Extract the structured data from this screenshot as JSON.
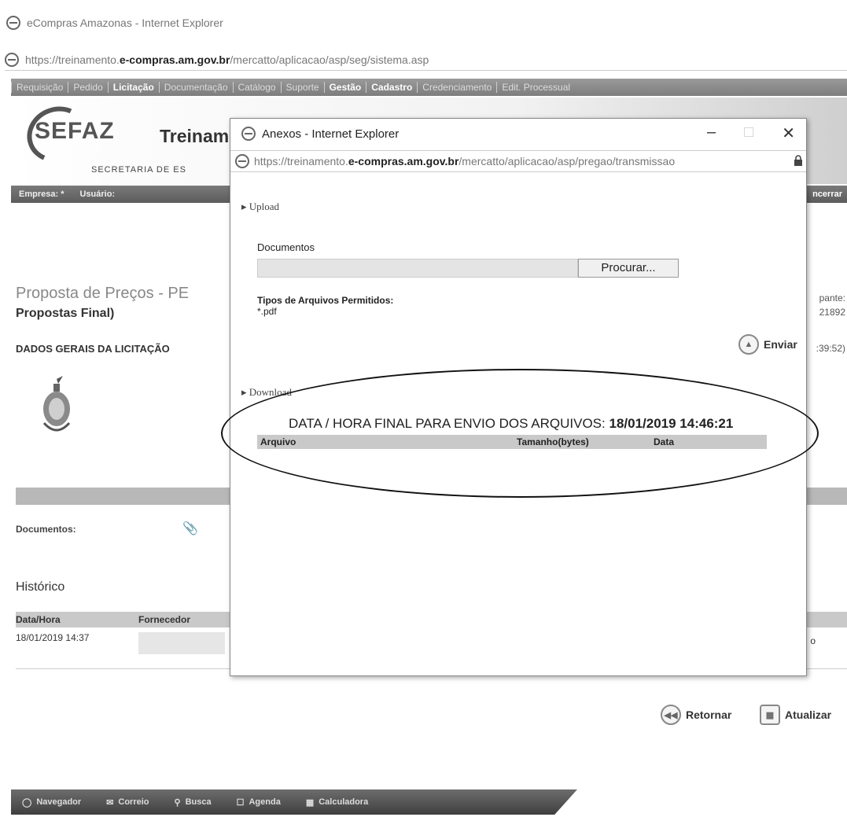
{
  "window": {
    "title": "eCompras Amazonas - Internet Explorer",
    "url_prefix": "https://treinamento.",
    "url_host": "e-compras.am.gov.br",
    "url_path": "/mercatto/aplicacao/asp/seg/sistema.asp"
  },
  "menu": {
    "items": [
      {
        "label": "Requisição",
        "bold": false
      },
      {
        "label": "Pedido",
        "bold": false
      },
      {
        "label": "Licitação",
        "bold": true
      },
      {
        "label": "Documentação",
        "bold": false
      },
      {
        "label": "Catálogo",
        "bold": false
      },
      {
        "label": "Suporte",
        "bold": false
      },
      {
        "label": "Gestão",
        "bold": true
      },
      {
        "label": "Cadastro",
        "bold": true
      },
      {
        "label": "Credenciamento",
        "bold": false
      },
      {
        "label": "Edit. Processual",
        "bold": false
      }
    ]
  },
  "header": {
    "logo": "SEFAZ",
    "title": "Treinam",
    "secretaria": "SECRETARIA DE ES",
    "empresa_label": "Empresa: *",
    "usuario_label": "Usuário:",
    "encerrar": "ncerrar"
  },
  "page": {
    "heading": "Proposta de Preços - PE",
    "subheading": "Propostas Final)",
    "right_label": "pante:",
    "right_number": "21892",
    "dados_gerais": "DADOS GERAIS DA LICITAÇÃO",
    "right_time": ":39:52)",
    "documentos_label": "Documentos:",
    "historico": "Histórico",
    "hist_columns": [
      "Data/Hora",
      "Fornecedor"
    ],
    "hist_row_date": "18/01/2019 14:37",
    "hist_row_tail": "o",
    "retornar": "Retornar",
    "atualizar": "Atualizar"
  },
  "taskbar": {
    "items": [
      "Navegador",
      "Correio",
      "Busca",
      "Agenda",
      "Calculadora"
    ]
  },
  "popup": {
    "title": "Anexos - Internet Explorer",
    "url_prefix": "https://treinamento.",
    "url_host": "e-compras.am.gov.br",
    "url_path": "/mercatto/aplicacao/asp/pregao/transmissao",
    "upload_label": "Upload",
    "documentos_label": "Documentos",
    "procurar": "Procurar...",
    "tipos_label": "Tipos de Arquivos Permitidos:",
    "tipos_value": "*.pdf",
    "enviar": "Enviar",
    "download_label": "Download",
    "data_hora_text": "DATA / HORA FINAL PARA ENVIO DOS ARQUIVOS:",
    "data_hora_value": "18/01/2019 14:46:21",
    "columns": [
      "Arquivo",
      "Tamanho(bytes)",
      "Data"
    ]
  }
}
